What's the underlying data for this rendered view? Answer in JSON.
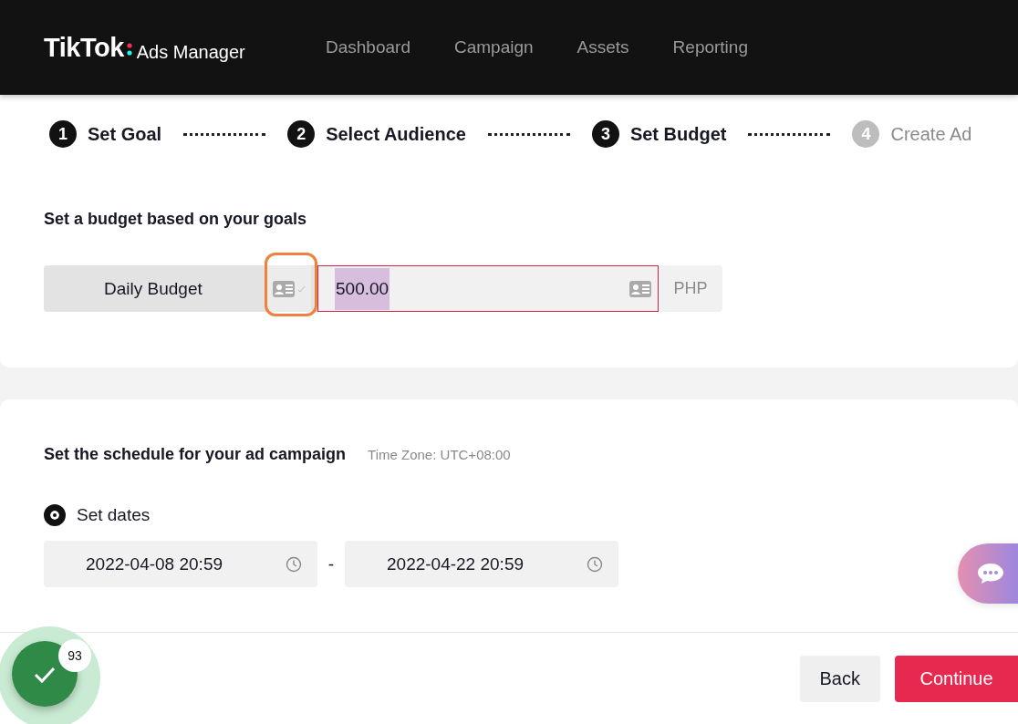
{
  "header": {
    "logo": {
      "brand": "TikTok",
      "product": "Ads Manager"
    },
    "nav": [
      {
        "label": "Dashboard",
        "selected": false
      },
      {
        "label": "Campaign",
        "selected": false
      },
      {
        "label": "Assets",
        "selected": false
      },
      {
        "label": "Reporting",
        "selected": false
      }
    ]
  },
  "steps": [
    {
      "number": "1",
      "label": "Set Goal",
      "enabled": true
    },
    {
      "number": "2",
      "label": "Select Audience",
      "enabled": true
    },
    {
      "number": "3",
      "label": "Set Budget",
      "enabled": true
    },
    {
      "number": "4",
      "label": "Create Ad",
      "enabled": false
    }
  ],
  "budget": {
    "title": "Set a budget based on your goals",
    "mode": "Daily Budget",
    "highlighted": true,
    "value": "500.00",
    "value_selected": true,
    "focused": true,
    "currency": "PHP"
  },
  "schedule": {
    "title": "Set the schedule for your ad campaign",
    "time_zone": "Time Zone: UTC+08:00",
    "options": [
      {
        "label": "Set dates",
        "selected": true
      }
    ],
    "start": "2022-04-08 20:59",
    "separator": "-",
    "end": "2022-04-22 20:59"
  },
  "footer": {
    "buttons": [
      {
        "label": "Back",
        "kind": "secondary"
      },
      {
        "label": "Continue",
        "kind": "primary"
      }
    ],
    "badge": {
      "count": "93"
    }
  }
}
